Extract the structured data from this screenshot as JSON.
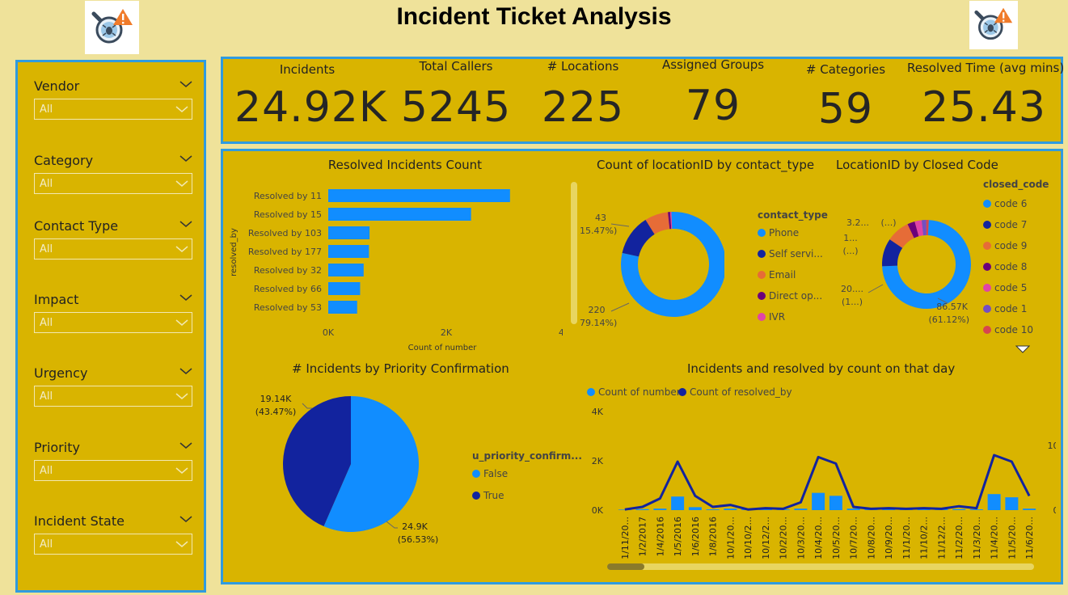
{
  "header": {
    "title": "Incident Ticket Analysis"
  },
  "slicers": [
    {
      "label": "Vendor",
      "value": "All"
    },
    {
      "label": "Category",
      "value": "All"
    },
    {
      "label": "Contact Type",
      "value": "All"
    },
    {
      "label": "Impact",
      "value": "All"
    },
    {
      "label": "Urgency",
      "value": "All"
    },
    {
      "label": "Priority",
      "value": "All"
    },
    {
      "label": "Incident State",
      "value": "All"
    }
  ],
  "kpis": [
    {
      "label": "Incidents",
      "value": "24.92K"
    },
    {
      "label": "Total Callers",
      "value": "5245"
    },
    {
      "label": "# Locations",
      "value": "225"
    },
    {
      "label": "Assigned Groups",
      "value": "79"
    },
    {
      "label": "# Categories",
      "value": "59"
    },
    {
      "label": "Resolved Time (avg mins)",
      "value": "25.43"
    }
  ],
  "colors": {
    "primary": "#118dff",
    "dark": "#12239e",
    "orange": "#e66c37",
    "maroon": "#6b007b",
    "pink": "#e044a7",
    "purple": "#744ec2",
    "panel": "#d9b400",
    "border": "#2f9be0"
  },
  "chart_data": [
    {
      "type": "bar",
      "title": "Resolved Incidents Count",
      "categories": [
        "Resolved by 11",
        "Resolved by 15",
        "Resolved by 103",
        "Resolved by 177",
        "Resolved by 32",
        "Resolved by 66",
        "Resolved by 53"
      ],
      "values": [
        3080,
        2420,
        700,
        690,
        600,
        540,
        490
      ],
      "xlabel": "Count of number",
      "ylabel": "resolved_by",
      "xticks": [
        "0K",
        "2K",
        "4K"
      ],
      "xlim": [
        0,
        4000
      ]
    },
    {
      "type": "pie",
      "title": "Count of locationID by contact_type",
      "legend_title": "contact_type",
      "categories": [
        "Phone",
        "Self servi...",
        "Email",
        "Direct op...",
        "IVR"
      ],
      "values": [
        220,
        35,
        20,
        2,
        1
      ],
      "data_labels": [
        {
          "value": "43",
          "pct": "(15.47%)"
        },
        {
          "value": "220",
          "pct": "(79.14%)"
        }
      ]
    },
    {
      "type": "pie",
      "title": "LocationID by Closed Code",
      "legend_title": "closed_code",
      "categories": [
        "code 6",
        "code 7",
        "code 9",
        "code 8",
        "code 5",
        "code 1",
        "code 10"
      ],
      "values": [
        86.57,
        12,
        10,
        3.2,
        3,
        2,
        1
      ],
      "data_labels": [
        {
          "value": "3.2...",
          "pct": "(...)"
        },
        {
          "value": "1...",
          "pct": "(...)"
        },
        {
          "value": "20....",
          "pct": "(1...)"
        },
        {
          "value": "86.57K",
          "pct": "(61.12%)"
        }
      ]
    },
    {
      "type": "pie",
      "title": "# Incidents by Priority Confirmation",
      "legend_title": "u_priority_confirm...",
      "categories": [
        "False",
        "True"
      ],
      "values": [
        24.9,
        19.14
      ],
      "data_labels": [
        {
          "value": "19.14K",
          "pct": "(43.47%)"
        },
        {
          "value": "24.9K",
          "pct": "(56.53%)"
        }
      ]
    },
    {
      "type": "bar",
      "title": "Incidents and resolved by count on that day",
      "legend": [
        "Count of number",
        "Count of resolved_by"
      ],
      "categories": [
        "1/11/20...",
        "1/2/2017",
        "1/4/2016",
        "1/5/2016",
        "1/6/2016",
        "1/8/2016",
        "10/1/20...",
        "10/10/2...",
        "10/12/2...",
        "10/2/20...",
        "10/3/20...",
        "10/4/20...",
        "10/5/20...",
        "10/7/20...",
        "10/8/20...",
        "10/9/20...",
        "11/1/20...",
        "11/10/2...",
        "11/12/2...",
        "11/2/20...",
        "11/3/20...",
        "11/4/20...",
        "11/5/20...",
        "11/6/20..."
      ],
      "series": [
        {
          "name": "Count of number",
          "values": [
            20,
            40,
            60,
            550,
            120,
            30,
            60,
            40,
            40,
            30,
            60,
            700,
            580,
            60,
            30,
            40,
            30,
            60,
            40,
            40,
            30,
            650,
            520,
            60
          ]
        },
        {
          "name": "Count of resolved_by",
          "values": [
            1,
            5,
            18,
            75,
            22,
            5,
            8,
            1,
            3,
            2,
            12,
            82,
            72,
            5,
            2,
            3,
            2,
            3,
            2,
            6,
            3,
            85,
            75,
            22
          ]
        }
      ],
      "yticks_left": [
        "0K",
        "2K",
        "4K"
      ],
      "ylim_left": [
        0,
        4000
      ],
      "yticks_right": [
        "0",
        "100"
      ],
      "ylim_right": [
        0,
        100
      ]
    }
  ]
}
